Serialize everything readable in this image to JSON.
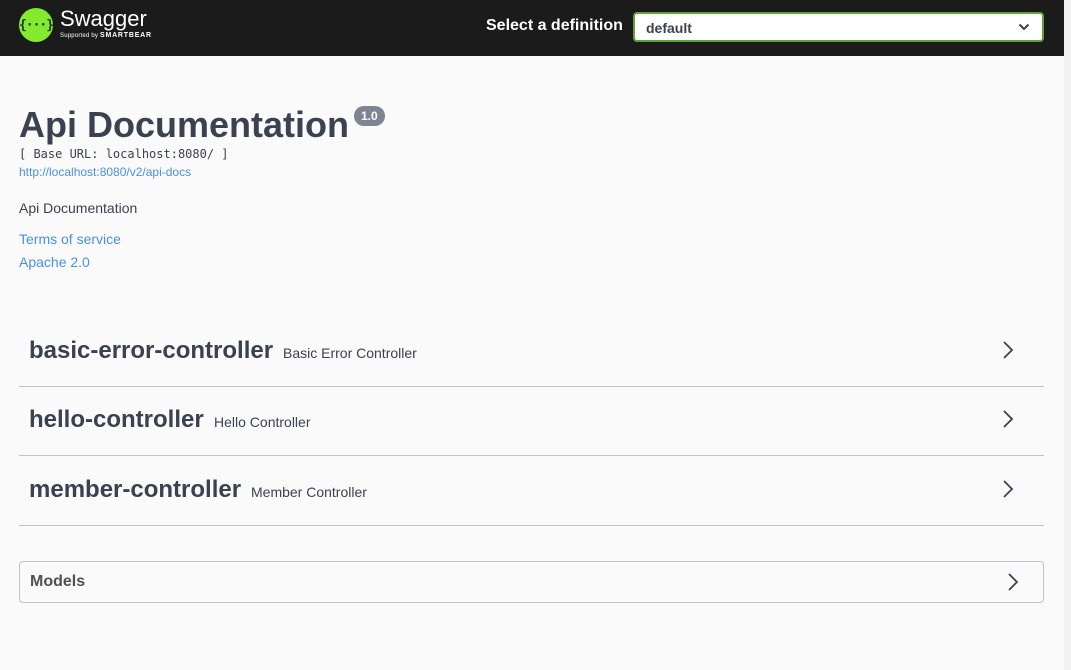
{
  "topbar": {
    "logo_name": "Swagger",
    "logo_sub_prefix": "Supported by",
    "logo_sub_brand": "SMARTBEAR",
    "logo_mark": "{···}",
    "definition_label": "Select a definition",
    "definition_selected": "default"
  },
  "info": {
    "title": "Api Documentation",
    "version": "1.0",
    "base_url": "[ Base URL: localhost:8080/ ]",
    "api_docs_link": "http://localhost:8080/v2/api-docs",
    "description": "Api Documentation",
    "terms_link": "Terms of service",
    "license_link": "Apache 2.0"
  },
  "tags": [
    {
      "name": "basic-error-controller",
      "description": "Basic Error Controller",
      "icon": "chevron-right-icon"
    },
    {
      "name": "hello-controller",
      "description": "Hello Controller",
      "icon": "chevron-right-icon"
    },
    {
      "name": "member-controller",
      "description": "Member Controller",
      "icon": "chevron-right-icon"
    }
  ],
  "models": {
    "label": "Models",
    "icon": "chevron-right-icon"
  },
  "colors": {
    "topbar_bg": "#1b1b1b",
    "logo_green": "#85ea2d",
    "select_border": "#62a03f",
    "link": "#4990e2",
    "text": "#3b4151",
    "version_badge": "#7d8492"
  }
}
